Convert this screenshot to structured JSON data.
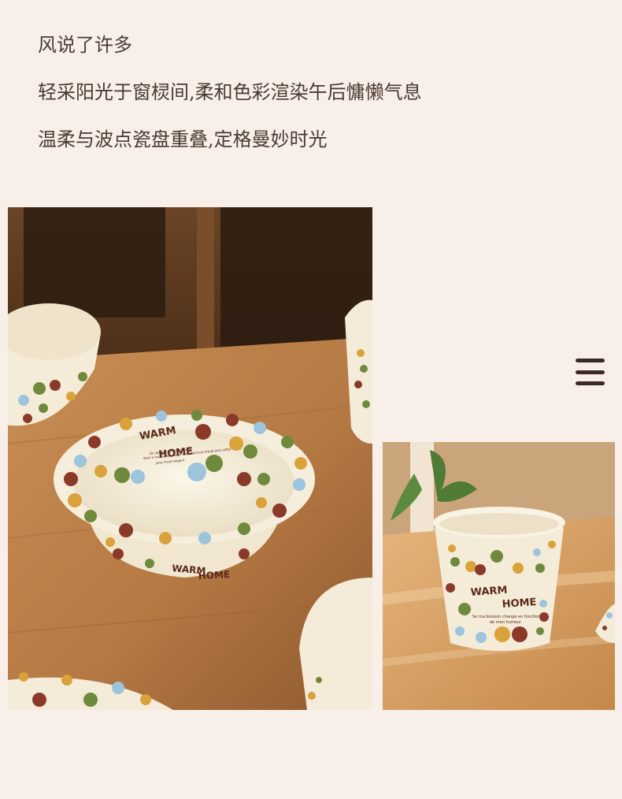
{
  "text": {
    "line1": "风说了许多",
    "line2": "轻采阳光于窗棂间,柔和色彩渲染午后慵懒气息",
    "line3": "温柔与波点瓷盘重叠,定格曼妙时光"
  },
  "photos": {
    "large": {
      "bowl_text_top": "WARM",
      "bowl_text_bottom": "HOME",
      "bowl_small_text": "Un après-midi tranquille",
      "bowl_small_text2": "Start a happy day today with delicious bread and coffee",
      "bowl_small_text3": "jane ritual elegant"
    },
    "small": {
      "cup_text_top": "WARM",
      "cup_text_bottom": "HOME",
      "cup_small_text": "Se ma boisson change en fonction",
      "cup_small_text2": "de mon humeur"
    }
  },
  "icons": {
    "menu": "hamburger-menu-icon"
  },
  "colors": {
    "background": "#f8efe9",
    "text": "#4a3a30",
    "menu": "#3b2a24",
    "dot_brown": "#8b3a2a",
    "dot_green": "#6f8a3c",
    "dot_blue": "#9cc4dc",
    "dot_mustard": "#d9a23a",
    "ceramic": "#f4ecd8"
  }
}
